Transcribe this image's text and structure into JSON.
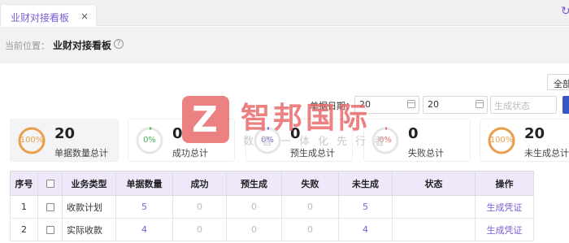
{
  "tab": {
    "title": "业财对接看板",
    "close": "×"
  },
  "refresh_icon": "↻",
  "breadcrumb": {
    "prefix": "当前位置：",
    "title": "业财对接看板",
    "help": "?"
  },
  "filters": {
    "all_button": "全部",
    "date_label": "单据日期：",
    "date_start": "20",
    "date_end": "20",
    "status_placeholder": "生成状态"
  },
  "cards": [
    {
      "percent": "100%",
      "value": "20",
      "label": "单据数量总计",
      "ring_color": "#e8a04c",
      "fill": 1.0
    },
    {
      "percent": "0%",
      "value": "0",
      "label": "成功总计",
      "ring_color": "#4caf50",
      "fill": 0.0
    },
    {
      "percent": "0%",
      "value": "0",
      "label": "预生成总计",
      "ring_color": "#7b5cd6",
      "fill": 0.0
    },
    {
      "percent": "0%",
      "value": "0",
      "label": "失败总计",
      "ring_color": "#e06c6c",
      "fill": 0.0
    },
    {
      "percent": "100%",
      "value": "20",
      "label": "未生成总计",
      "ring_color": "#e8a04c",
      "fill": 1.0
    }
  ],
  "watermark": {
    "logo_letter": "Z",
    "name": "智邦国际",
    "slogan": "数智一体化先行者"
  },
  "table": {
    "headers": [
      "序号",
      "",
      "业务类型",
      "单据数量",
      "成功",
      "预生成",
      "失败",
      "未生成",
      "状态",
      "操作"
    ],
    "rows": [
      {
        "idx": "1",
        "type": "收款计划",
        "count": "5",
        "success": "0",
        "pre": "0",
        "fail": "0",
        "ungen": "5",
        "status": "",
        "action": "生成凭证"
      },
      {
        "idx": "2",
        "type": "实际收款",
        "count": "4",
        "success": "0",
        "pre": "0",
        "fail": "0",
        "ungen": "4",
        "status": "",
        "action": "生成凭证"
      }
    ]
  }
}
